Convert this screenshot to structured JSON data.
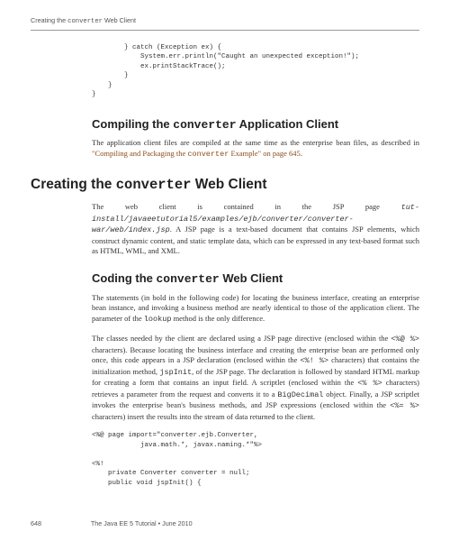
{
  "runningHead": {
    "prefix": "Creating the ",
    "code": "converter",
    "suffix": " Web Client"
  },
  "codeBlock1": "        } catch (Exception ex) {\n            System.err.println(\"Caught an unexpected exception!\");\n            ex.printStackTrace();\n        }\n    }\n}",
  "section1": {
    "prefix": "Compiling the ",
    "code": "converter",
    "suffix": " Application Client"
  },
  "para1": {
    "text": "The application client files are compiled at the same time as the enterprise bean files, as described in ",
    "linkText": "\"Compiling and Packaging the ",
    "linkCode": "converter",
    "linkSuffix": " Example\" on page 645",
    "end": "."
  },
  "mainHeading": {
    "prefix": "Creating the ",
    "code": "converter",
    "suffix": " Web Client"
  },
  "para2a": "The web client is contained in the JSP page",
  "para2b": "tut-install/javaeetutorial5/examples/ejb/converter/converter-war/web/index.jsp",
  "para2c": ". A JSP page is a text-based document that contains JSP elements, which construct dynamic content, and static template data, which can be expressed in any text-based format such as HTML, WML, and XML.",
  "section2": {
    "prefix": "Coding the ",
    "code": "converter",
    "suffix": " Web Client"
  },
  "para3a": "The statements (in bold in the following code) for locating the business interface, creating an enterprise bean instance, and invoking a business method are nearly identical to those of the application client. The parameter of the ",
  "para3code": "lookup",
  "para3b": " method is the only difference.",
  "para4a": "The classes needed by the client are declared using a JSP page directive (enclosed within the ",
  "para4c1": "<%@ %>",
  "para4b": " characters). Because locating the business interface and creating the enterprise bean are performed only once, this code appears in a JSP declaration (enclosed within the ",
  "para4c2": "<%! %>",
  "para4c": " characters) that contains the initialization method, ",
  "para4c3": "jspInit",
  "para4d": ", of the JSP page. The declaration is followed by standard HTML markup for creating a form that contains an input field. A scriptlet (enclosed within the ",
  "para4c4": "<% %>",
  "para4e": " characters) retrieves a parameter from the request and converts it to a ",
  "para4c5": "BigDecimal",
  "para4f": " object. Finally, a JSP scriptlet invokes the enterprise bean's business methods, and JSP expressions (enclosed within the ",
  "para4c6": "<%= %>",
  "para4g": " characters) insert the results into the stream of data returned to the client.",
  "codeBlock2": "<%@ page import=\"converter.ejb.Converter,\n            java.math.*, javax.naming.*\"%>\n\n<%!\n    private Converter converter = null;\n    public void jspInit() {",
  "footer": {
    "pageNum": "648",
    "title": "The Java EE 5 Tutorial  •  June 2010"
  }
}
